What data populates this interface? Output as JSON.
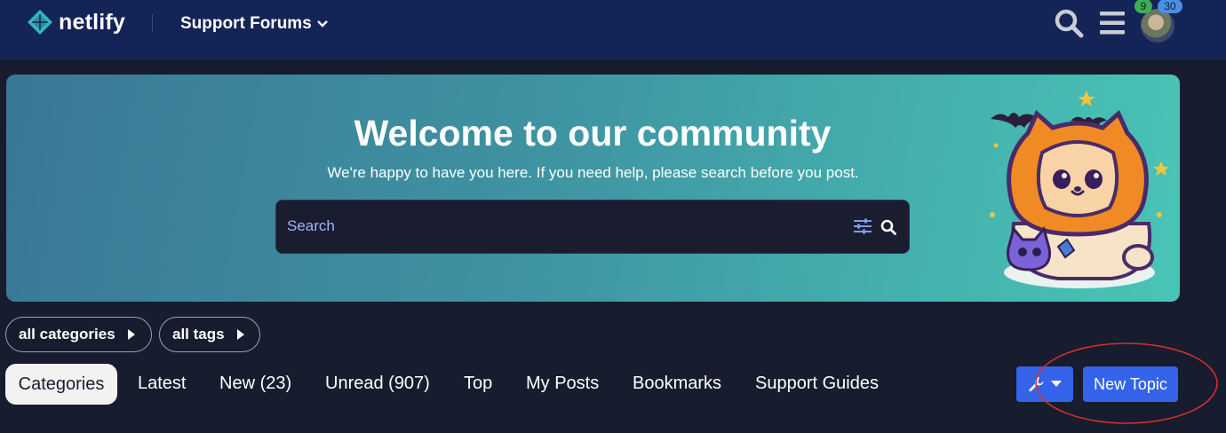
{
  "header": {
    "brand": "netlify",
    "forum_title": "Support Forums",
    "notification_count_green": "9",
    "notification_count_blue": "30"
  },
  "banner": {
    "title": "Welcome to our community",
    "subtitle": "We're happy to have you here. If you need help, please search before you post.",
    "search_placeholder": "Search"
  },
  "filters": {
    "categories_label": "all categories",
    "tags_label": "all tags"
  },
  "nav": {
    "items": [
      "Categories",
      "Latest",
      "New (23)",
      "Unread (907)",
      "Top",
      "My Posts",
      "Bookmarks",
      "Support Guides"
    ],
    "active_index": 0
  },
  "actions": {
    "new_topic_label": "New Topic"
  },
  "colors": {
    "header_bg": "#152456",
    "page_bg": "#171c2e",
    "accent": "#3563e9",
    "annotation": "#d32f2f"
  }
}
